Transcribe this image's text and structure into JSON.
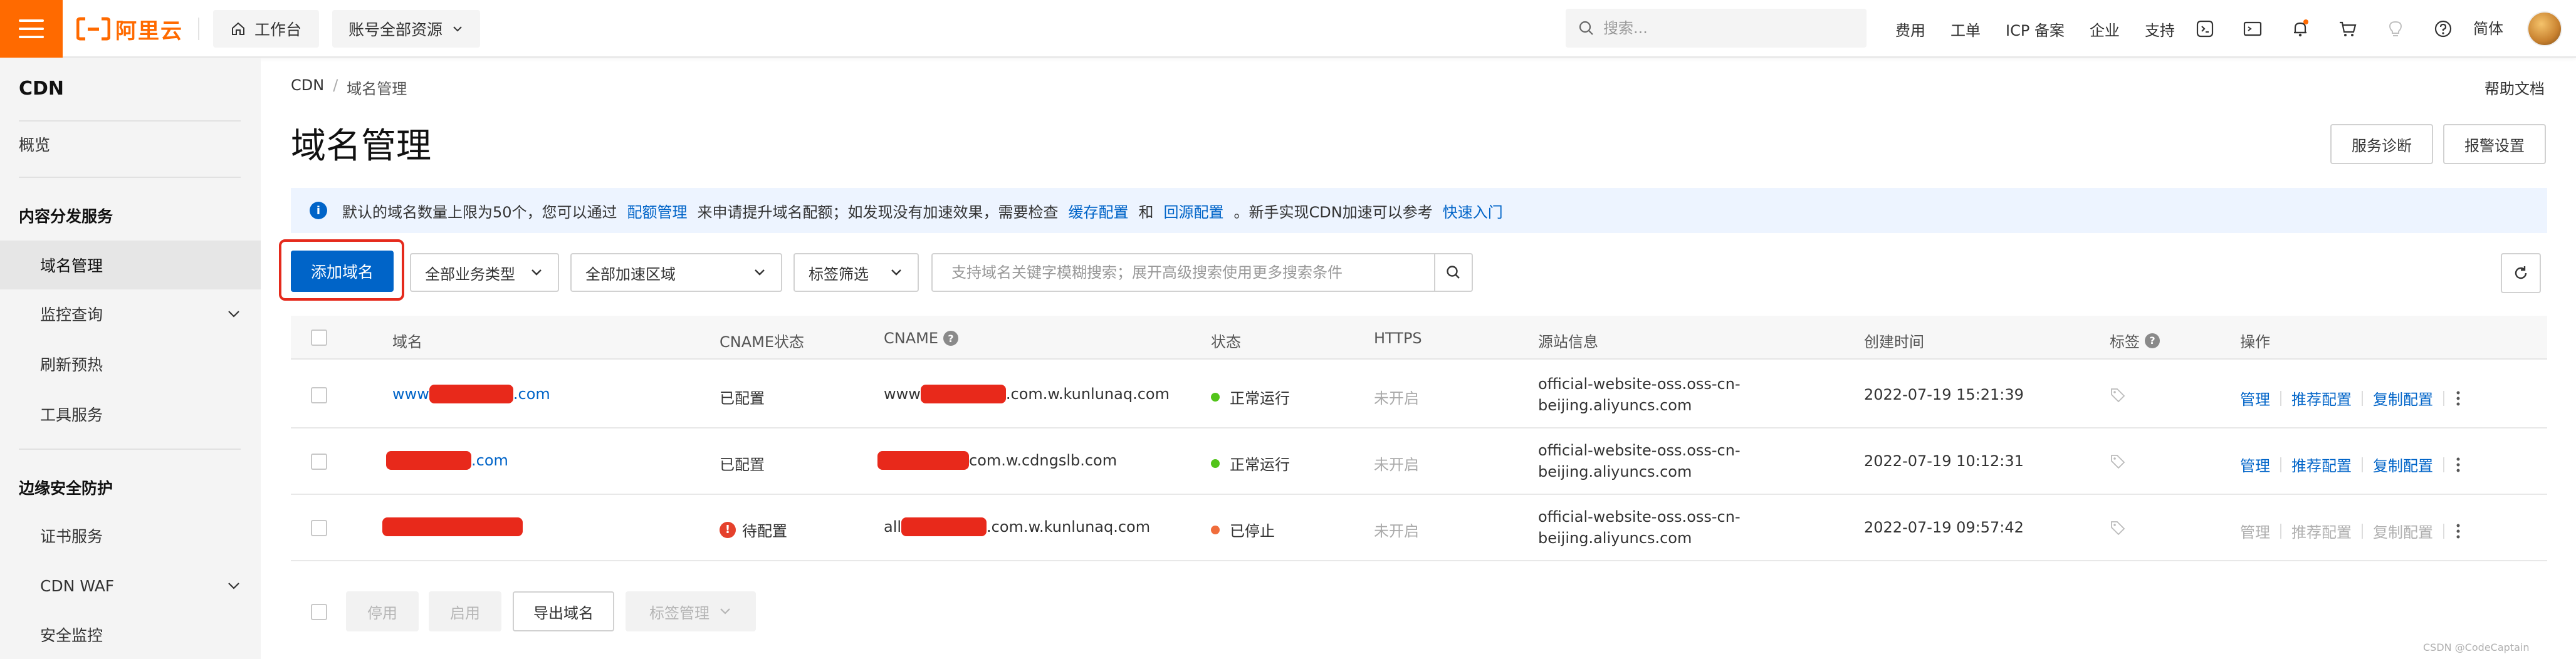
{
  "topbar": {
    "logo_text": "阿里云",
    "workbench_label": "工作台",
    "account_label": "账号全部资源",
    "search_placeholder": "搜索...",
    "nav_links": [
      "费用",
      "工单",
      "ICP 备案",
      "企业",
      "支持"
    ],
    "language": "简体",
    "brand_color": "#ff6a00"
  },
  "sidebar": {
    "title": "CDN",
    "overview": "概览",
    "group1": "内容分发服务",
    "group1_items": [
      "域名管理",
      "监控查询",
      "刷新预热",
      "工具服务"
    ],
    "group2": "边缘安全防护",
    "group2_items": [
      "证书服务",
      "CDN WAF",
      "安全监控"
    ],
    "active_item": "域名管理"
  },
  "breadcrumb": {
    "root": "CDN",
    "separator": "/",
    "current": "域名管理"
  },
  "help_doc": "帮助文档",
  "page_title": "域名管理",
  "header_buttons": {
    "diagnose": "服务诊断",
    "alarm": "报警设置"
  },
  "notice": {
    "part1": "默认的域名数量上限为50个，您可以通过",
    "link1": "配额管理",
    "part2": "来申请提升域名配额；如发现没有加速效果，需要检查",
    "link2": "缓存配置",
    "part3": "和",
    "link3": "回源配置",
    "part4": "。新手实现CDN加速可以参考",
    "link4": "快速入门"
  },
  "toolbar": {
    "add_domain": "添加域名",
    "business_type": "全部业务类型",
    "region": "全部加速区域",
    "tag_filter": "标签筛选",
    "search_placeholder": "支持域名关键字模糊搜索；展开高级搜索使用更多搜索条件"
  },
  "table": {
    "headers": {
      "domain": "域名",
      "cname_status": "CNAME状态",
      "cname": "CNAME",
      "status": "状态",
      "https": "HTTPS",
      "origin": "源站信息",
      "created": "创建时间",
      "tags": "标签",
      "actions": "操作"
    },
    "rows": [
      {
        "domain_prefix": "www",
        "domain_suffix": ".com",
        "cname_status": "已配置",
        "cname_prefix": "www",
        "cname_suffix": ".com.w.kunlunaq.com",
        "status": "正常运行",
        "status_color": "#52c41a",
        "https": "未开启",
        "origin_line1": "official-website-oss.oss-cn-",
        "origin_line2": "beijing.aliyuncs.com",
        "created": "2022-07-19 15:21:39",
        "action_manage": "管理",
        "action_recommend": "推荐配置",
        "action_copy": "复制配置"
      },
      {
        "domain_prefix": "",
        "domain_suffix": ".com",
        "cname_status": "已配置",
        "cname_prefix": "",
        "cname_suffix": "com.w.cdngslb.com",
        "status": "正常运行",
        "status_color": "#52c41a",
        "https": "未开启",
        "origin_line1": "official-website-oss.oss-cn-",
        "origin_line2": "beijing.aliyuncs.com",
        "created": "2022-07-19 10:12:31",
        "action_manage": "管理",
        "action_recommend": "推荐配置",
        "action_copy": "复制配置"
      },
      {
        "domain_prefix": "",
        "domain_suffix": "",
        "cname_status": "待配置",
        "cname_prefix": "all",
        "cname_suffix": ".com.w.kunlunaq.com",
        "status": "已停止",
        "status_color": "#f06d3c",
        "https": "未开启",
        "origin_line1": "official-website-oss.oss-cn-",
        "origin_line2": "beijing.aliyuncs.com",
        "created": "2022-07-19 09:57:42",
        "action_manage": "管理",
        "action_recommend": "推荐配置",
        "action_copy": "复制配置"
      }
    ]
  },
  "footer": {
    "disable": "停用",
    "enable": "启用",
    "export": "导出域名",
    "tag_manage": "标签管理"
  },
  "watermark": "CSDN @CodeCaptain"
}
